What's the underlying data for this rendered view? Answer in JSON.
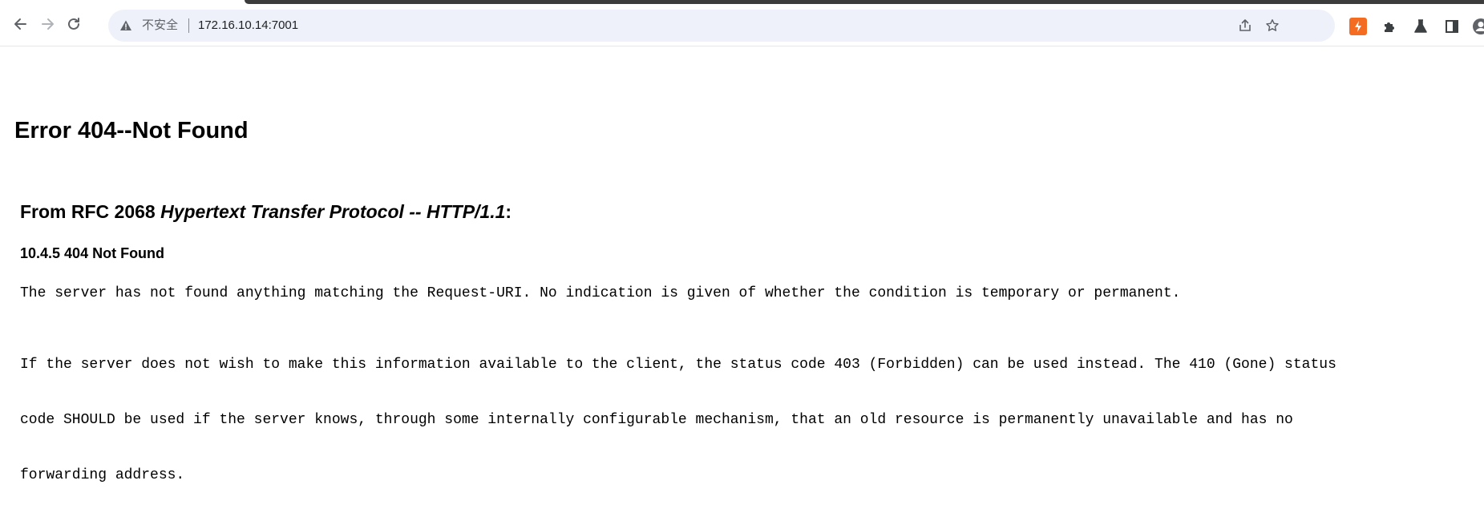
{
  "browser": {
    "back_icon": "arrow-left-icon",
    "forward_icon": "arrow-right-icon",
    "reload_icon": "reload-icon",
    "security_icon": "warning-triangle-icon",
    "security_label": "不安全",
    "url": "172.16.10.14:7001",
    "share_icon": "share-icon",
    "bookmark_icon": "star-icon",
    "extensions": [
      {
        "name": "red-extension-icon",
        "color": "#f36c21"
      },
      {
        "name": "puzzle-extensions-icon"
      },
      {
        "name": "labs-flask-icon"
      },
      {
        "name": "side-panel-icon"
      }
    ]
  },
  "page": {
    "title": "Error 404--Not Found",
    "rfc_prefix": "From RFC 2068 ",
    "rfc_title": "Hypertext Transfer Protocol -- HTTP/1.1",
    "rfc_suffix": ":",
    "section": "10.4.5 404 Not Found",
    "para1": "The server has not found anything matching the Request-URI. No indication is given of whether the condition is temporary or permanent.",
    "para2_line1": "If the server does not wish to make this information available to the client, the status code 403 (Forbidden) can be used instead. The 410 (Gone) status",
    "para2_line2": "code SHOULD be used if the server knows, through some internally configurable mechanism, that an old resource is permanently unavailable and has no",
    "para2_line3": "forwarding address."
  }
}
